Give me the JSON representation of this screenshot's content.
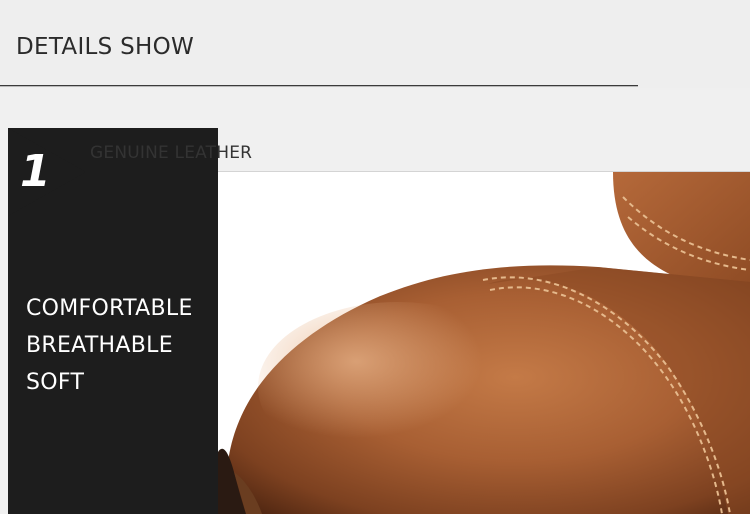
{
  "header": {
    "title": "DETAILS SHOW"
  },
  "section": {
    "number": "1",
    "title": "GENUINE LEATHER",
    "features": [
      "COMFORTABLE",
      "BREATHABLE",
      "SOFT"
    ]
  },
  "image": {
    "subject": "leather-shoe-toe-closeup"
  }
}
